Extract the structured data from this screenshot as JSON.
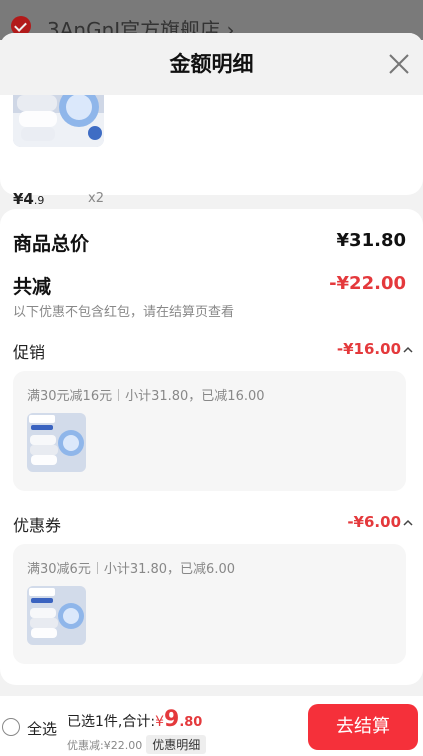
{
  "store": {
    "name": "3AnGnI官方旗舰店 ›"
  },
  "sheet": {
    "title": "金额明细"
  },
  "item": {
    "price_int": "¥4",
    "price_dec": ".9",
    "quantity": "x2"
  },
  "summary": {
    "total_label": "商品总价",
    "total_value": "¥31.80",
    "reduce_label": "共减",
    "reduce_value": "-¥22.00",
    "note": "以下优惠不包含红包，请在结算页查看"
  },
  "promotion": {
    "label": "促销",
    "value": "-¥16.00",
    "rule": "满30元减16元",
    "detail": "小计31.80，已减16.00"
  },
  "coupon": {
    "label": "优惠券",
    "value": "-¥6.00",
    "rule": "满30减6元",
    "detail": "小计31.80，已减6.00"
  },
  "footer": {
    "select_all": "全选",
    "selected_text": "已选1件,合计:",
    "currency": "¥",
    "total_int": "9",
    "total_dec": ".80",
    "discount_text": "优惠减:¥22.00",
    "detail_button": "优惠明细",
    "checkout_button": "去结算"
  },
  "colors": {
    "accent_red": "#e4393c",
    "button_red": "#f5303a"
  }
}
